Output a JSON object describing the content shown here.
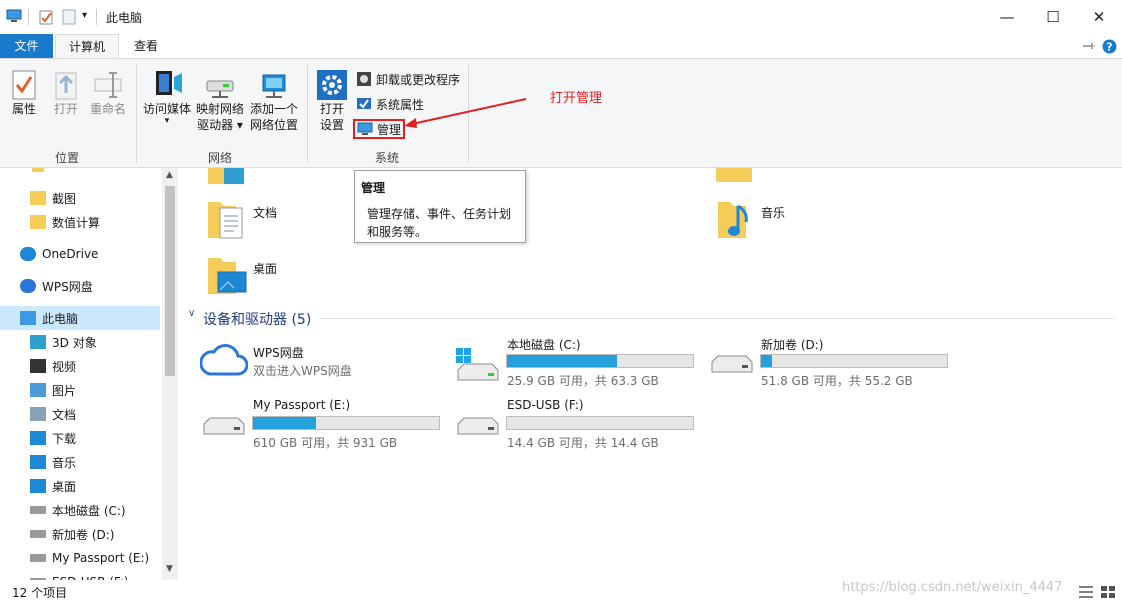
{
  "window": {
    "title": "此电脑",
    "minimize": "—",
    "maximize": "☐",
    "close": "✕"
  },
  "tabs": {
    "file": "文件",
    "computer": "计算机",
    "view": "查看"
  },
  "ribbon": {
    "location": {
      "properties": "属性",
      "open": "打开",
      "rename": "重命名",
      "group": "位置"
    },
    "network": {
      "access_media": "访问媒体",
      "map_drive_1": "映射网络",
      "map_drive_2": "驱动器 ▾",
      "add_location_1": "添加一个",
      "add_location_2": "网络位置",
      "group": "网络"
    },
    "system": {
      "open_settings_1": "打开",
      "open_settings_2": "设置",
      "uninstall": "卸载或更改程序",
      "sys_props": "系统属性",
      "manage": "管理",
      "group": "系统"
    }
  },
  "annotation": {
    "text": "打开管理",
    "color": "#e02020"
  },
  "tooltip": {
    "title": "管理",
    "line1": "管理存储、事件、任务计划",
    "line2": "和服务等。"
  },
  "sidebar": {
    "items": [
      {
        "label": "截图",
        "icon": "folder-icon"
      },
      {
        "label": "数值计算",
        "icon": "folder-icon"
      },
      {
        "label": "OneDrive",
        "icon": "cloud-icon"
      },
      {
        "label": "WPS网盘",
        "icon": "wps-cloud-icon"
      },
      {
        "label": "此电脑",
        "icon": "computer-icon"
      },
      {
        "label": "3D 对象",
        "icon": "3d-objects-icon"
      },
      {
        "label": "视频",
        "icon": "video-icon"
      },
      {
        "label": "图片",
        "icon": "pictures-icon"
      },
      {
        "label": "文档",
        "icon": "documents-icon"
      },
      {
        "label": "下载",
        "icon": "download-icon"
      },
      {
        "label": "音乐",
        "icon": "music-icon"
      },
      {
        "label": "桌面",
        "icon": "desktop-icon"
      },
      {
        "label": "本地磁盘 (C:)",
        "icon": "drive-icon"
      },
      {
        "label": "新加卷 (D:)",
        "icon": "drive-icon"
      },
      {
        "label": "My Passport (E:)",
        "icon": "drive-icon"
      },
      {
        "label": "ESD-USB (F:)",
        "icon": "drive-icon"
      }
    ]
  },
  "folders": [
    {
      "label": "文档"
    },
    {
      "label": "音乐"
    },
    {
      "label": "桌面"
    }
  ],
  "devices": {
    "header": "设备和驱动器 (5)",
    "wps": {
      "name": "WPS网盘",
      "sub": "双击进入WPS网盘"
    },
    "c": {
      "name": "本地磁盘 (C:)",
      "sub": "25.9 GB 可用，共 63.3 GB",
      "used_fraction": 0.59
    },
    "d": {
      "name": "新加卷 (D:)",
      "sub": "51.8 GB 可用，共 55.2 GB",
      "used_fraction": 0.06
    },
    "e": {
      "name": "My Passport (E:)",
      "sub": "610 GB 可用，共 931 GB",
      "used_fraction": 0.34
    },
    "f": {
      "name": "ESD-USB (F:)",
      "sub": "14.4 GB 可用，共 14.4 GB",
      "used_fraction": 0.0
    }
  },
  "status": {
    "count": "12 个项目"
  },
  "watermark": "https://blog.csdn.net/weixin_4447"
}
